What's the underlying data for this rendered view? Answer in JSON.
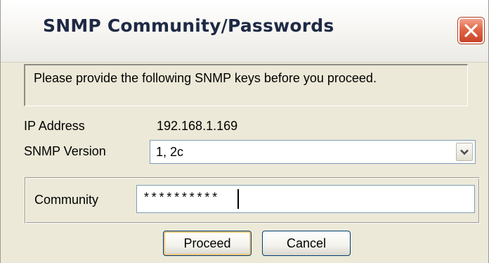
{
  "window": {
    "title": "SNMP Community/Passwords"
  },
  "message": "Please provide the following SNMP keys before you proceed.",
  "fields": {
    "ip_address_label": "IP Address",
    "ip_address_value": "192.168.1.169",
    "snmp_version_label": "SNMP Version",
    "snmp_version_value": "1, 2c",
    "community_label": "Community",
    "community_value": "**********"
  },
  "buttons": {
    "proceed": "Proceed",
    "cancel": "Cancel"
  },
  "icons": {
    "close": "close-icon",
    "dropdown": "chevron-down-icon"
  },
  "colors": {
    "window_bg": "#ece9d8",
    "close_button": "#e06645",
    "input_border": "#7f9db9",
    "button_border": "#003c74",
    "default_button_glow": "#f0c67a"
  }
}
